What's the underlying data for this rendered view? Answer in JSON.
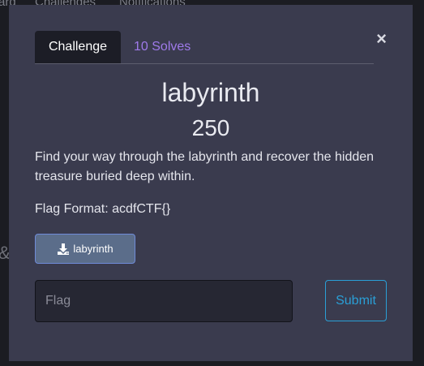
{
  "background": {
    "nav_items": [
      "ard",
      "Challenges",
      "Notifications"
    ],
    "side_glyph": "&"
  },
  "modal": {
    "tabs": [
      {
        "label": "Challenge",
        "active": true
      },
      {
        "label": "10 Solves",
        "active": false
      }
    ],
    "close_label": "×",
    "challenge": {
      "name": "labyrinth",
      "value": "250",
      "description": "Find your way through the labyrinth and recover the hidden treasure buried deep within.",
      "flag_format": "Flag Format: acdfCTF{}"
    },
    "download": {
      "icon": "download-icon",
      "label": "labyrinth"
    },
    "flag_input": {
      "placeholder": "Flag",
      "value": ""
    },
    "submit_label": "Submit"
  },
  "colors": {
    "modal_bg": "#3a3b4e",
    "active_tab_bg": "#1c1d26",
    "link_purple": "#9f7aea",
    "submit_blue": "#2a9fd6",
    "download_bg": "#5b6d8a"
  }
}
